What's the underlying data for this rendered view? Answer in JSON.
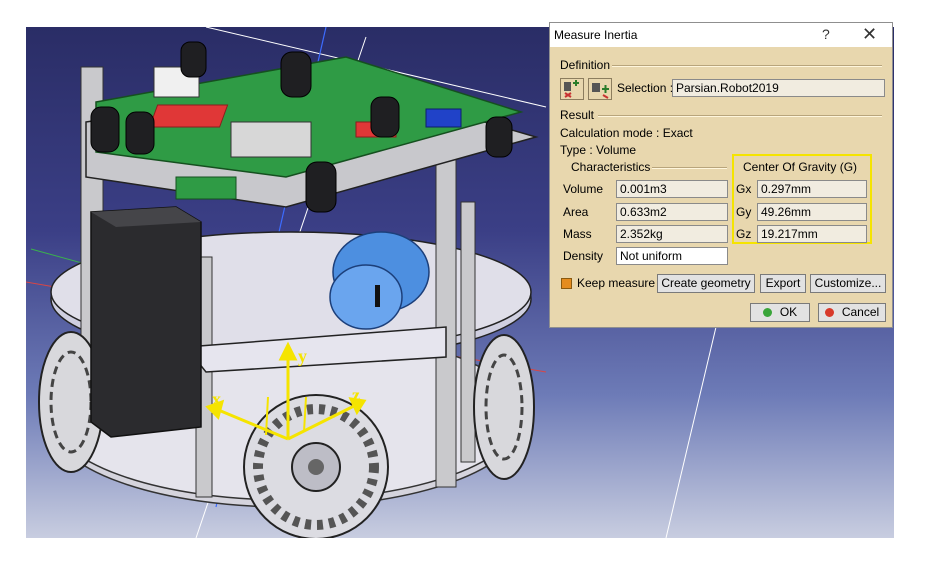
{
  "dialog": {
    "title": "Measure Inertia",
    "help": "?",
    "close": "✕",
    "definition": {
      "header": "Definition",
      "selection_label": "Selection :",
      "selection_value": "Parsian.Robot2019"
    },
    "result": {
      "header": "Result",
      "calc_mode": "Calculation mode : Exact",
      "type": "Type : Volume"
    },
    "characteristics": {
      "header": "Characteristics",
      "rows": [
        {
          "label": "Volume",
          "value": "0.001m3"
        },
        {
          "label": "Area",
          "value": "0.633m2"
        },
        {
          "label": "Mass",
          "value": "2.352kg"
        },
        {
          "label": "Density",
          "value": "Not uniform"
        }
      ]
    },
    "center_of_gravity": {
      "header": "Center Of Gravity (G)",
      "rows": [
        {
          "label": "Gx",
          "value": "0.297mm"
        },
        {
          "label": "Gy",
          "value": "49.26mm"
        },
        {
          "label": "Gz",
          "value": "19.217mm"
        }
      ],
      "highlight_color": "#f5e400"
    },
    "keep_measure": {
      "label": "Keep measure",
      "checked": true
    },
    "buttons": {
      "create_geometry": "Create geometry",
      "export": "Export",
      "customize": "Customize...",
      "ok": "OK",
      "cancel": "Cancel"
    },
    "colors": {
      "background": "#e8d7ae",
      "ok_dot": "#3aa53a",
      "cancel_dot": "#d83a2a"
    }
  },
  "viewport": {
    "axis_labels": {
      "x": "x",
      "y": "y",
      "z": "z"
    },
    "axis_color": "#f5e400"
  }
}
